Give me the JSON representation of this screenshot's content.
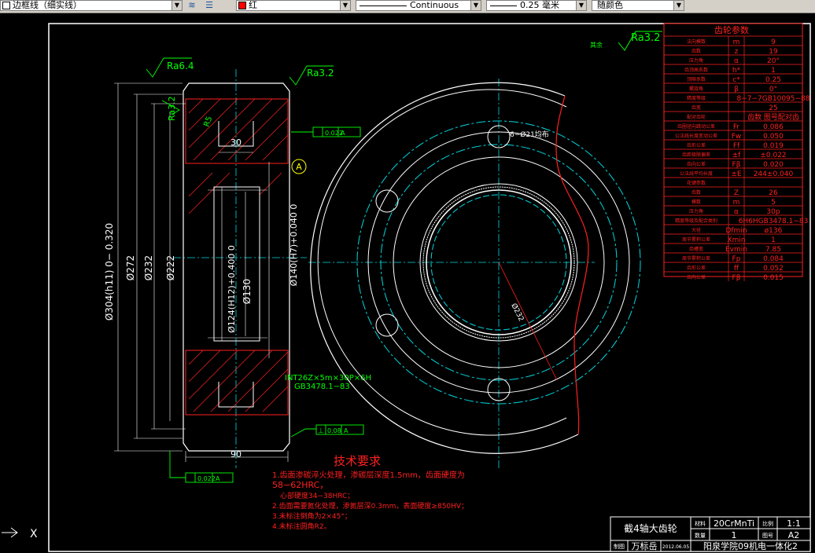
{
  "toolbar": {
    "layer_name": "边框线（细实线）",
    "color": "红",
    "linetype": "Continuous",
    "lineweight": "0.25 毫米",
    "plotstyle": "随颜色"
  },
  "drawing": {
    "surface_note": "其余",
    "surface_roughness_main": "Ra3.2",
    "ra_left_top": "Ra6.4",
    "ra_right_top": "Ra3.2",
    "ra_left_side": "Ra3.2",
    "r_note": "R5",
    "runout_top": "0.022",
    "runout_top_ref": "A",
    "runout_bottom": "0.022",
    "runout_bottom_ref": "A",
    "perp_tol": "0.08",
    "perp_ref": "A",
    "datum": "A",
    "dim_hub_width": "30",
    "dim_face_width": "90",
    "dim_od": "Ø304(h11) 0− 0.320",
    "dim_272": "Ø272",
    "dim_232": "Ø232",
    "dim_222": "Ø222",
    "dim_bore": "Ø124(H12)+0.400 0",
    "dim_130": "Ø130",
    "dim_140": "Ø140(H7)+0.040 0",
    "spline_spec_1": "INT26Z×5m×30P×6H",
    "spline_spec_2": "GB3478.1−83",
    "hole_note": "6−Ø21均布",
    "pcd_note": "Ø232",
    "tech_title": "技术要求",
    "tech_lines": [
      "1.齿面渗碳淬火处理，渗碳层深度1.5mm，齿面硬度为",
      "58−62HRC，",
      "心部硬度34−38HRC；",
      "2.齿面需要氮化处理，渗氮层深0.3mm，表面硬度≥850HV；",
      "3.未标注倒角为2×45°；",
      "4.未标注圆角R2。"
    ]
  },
  "gear_table": {
    "title": "齿轮参数",
    "rows": [
      {
        "name": "法向模数",
        "sym": "m",
        "val": "9"
      },
      {
        "name": "齿数",
        "sym": "z",
        "val": "19"
      },
      {
        "name": "压力角",
        "sym": "α",
        "val": "20°"
      },
      {
        "name": "齿顶高系数",
        "sym": "h*",
        "val": "1"
      },
      {
        "name": "顶隙系数",
        "sym": "c*",
        "val": "0.25"
      },
      {
        "name": "螺旋角",
        "sym": "β",
        "val": "0°"
      },
      {
        "name": "精度等级",
        "sym": "",
        "val": "8−7−7GB10095−88"
      },
      {
        "name": "齿宽",
        "sym": "",
        "val": "25"
      },
      {
        "name": "配对齿轮",
        "sym": "",
        "val": "齿数 图号配对齿"
      },
      {
        "name": "齿圈径向跳动公差",
        "sym": "Fr",
        "val": "0.086"
      },
      {
        "name": "公法线长度变动公差",
        "sym": "Fw",
        "val": "0.050"
      },
      {
        "name": "齿形公差",
        "sym": "Ff",
        "val": "0.019"
      },
      {
        "name": "齿距极限偏差",
        "sym": "±f",
        "val": "±0.022"
      },
      {
        "name": "齿向公差",
        "sym": "Fβ",
        "val": "0.020"
      },
      {
        "name": "公法线平均长度",
        "sym": "±E",
        "val": "244±0.040"
      },
      {
        "name": "花键参数",
        "sym": "",
        "val": ""
      },
      {
        "name": "齿数",
        "sym": "Z",
        "val": "26"
      },
      {
        "name": "模数",
        "sym": "m",
        "val": "5"
      },
      {
        "name": "压力角",
        "sym": "α",
        "val": "30p"
      },
      {
        "name": "精度等级及配合类别",
        "sym": "",
        "val": "6H6HGB3478.1−83"
      },
      {
        "name": "大径",
        "sym": "Dfmin",
        "val": "ø136"
      },
      {
        "name": "周节累积公差",
        "sym": "Xmin",
        "val": "1"
      },
      {
        "name": "齿槽宽",
        "sym": "Evmin",
        "val": "7.85"
      },
      {
        "name": "周节累积公差",
        "sym": "Fp",
        "val": "0.084"
      },
      {
        "name": "齿形公差",
        "sym": "ff",
        "val": "0.052"
      },
      {
        "name": "齿向公差",
        "sym": "Fβ",
        "val": "0.015"
      }
    ]
  },
  "title_block": {
    "drawing_name": "截4轴大齿轮",
    "material_label": "材料",
    "material": "20CrMnTi",
    "scale_label": "比例",
    "scale": "1:1",
    "qty_label": "数量",
    "qty": "1",
    "sheet_label": "图号",
    "sheet": "A2",
    "drawer_label": "制图",
    "drawer": "万标岳",
    "date": "2012.06.05",
    "school": "阳泉学院09机电一体化2"
  },
  "status": {
    "ucs_x": "X"
  },
  "colors": {
    "bg": "#000000",
    "white": "#ffffff",
    "red": "#ff2020",
    "green": "#00ff00",
    "cyan": "#00d8e0",
    "yellow": "#ffff00"
  }
}
